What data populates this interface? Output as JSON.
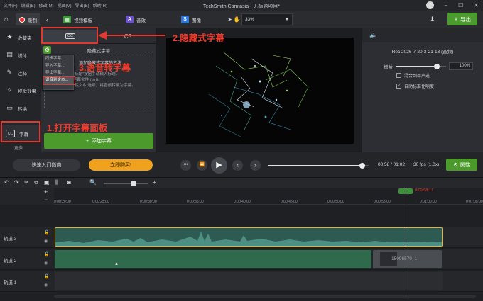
{
  "titlebar": {
    "menus": [
      "文件(F)",
      "编辑(E)",
      "修改(M)",
      "视图(V)",
      "导出(E)",
      "帮助(H)"
    ],
    "app_title": "TechSmith Camtasia - 无标题项目*"
  },
  "toolbar": {
    "record_label": "录制",
    "tabs": [
      {
        "label": "视频模板",
        "color": "#3e9b3a",
        "glyph": "▦"
      },
      {
        "label": "音效",
        "color": "#6c52c7",
        "glyph": "A"
      },
      {
        "label": "图像",
        "color": "#2f76d6",
        "glyph": "S"
      }
    ],
    "zoom": "33%",
    "export_label": "导出"
  },
  "sidebar": {
    "items": [
      {
        "label": "收藏夹",
        "icon": "star-icon",
        "glyph": "★"
      },
      {
        "label": "媒体",
        "icon": "media-icon",
        "glyph": "▤"
      },
      {
        "label": "注释",
        "icon": "annotation-icon",
        "glyph": "✎"
      },
      {
        "label": "视觉效果",
        "icon": "visual-effects-icon",
        "glyph": "✧"
      },
      {
        "label": "转换",
        "icon": "transition-icon",
        "glyph": "▭"
      },
      {
        "label": "字幕",
        "icon": "cc-icon",
        "glyph": "CC"
      }
    ],
    "more_label": "更多"
  },
  "caption_panel": {
    "tab_cc": "CC",
    "tab_c3": "C3",
    "title": "隐藏式字幕",
    "dropdown": [
      "同步字幕...",
      "导入字幕...",
      "导出字幕...",
      "语音到文本..."
    ],
    "guide_title": "添加隐藏式字幕的方法",
    "guide_lines": [
      "- 单击\"添加标题\"按钮手动输入标题。",
      "- 拖拽现有字幕文件 (.srt)。",
      "- 选择\"语音转文本\"选项，将音频转录为字幕。"
    ],
    "add_button": "添加字幕"
  },
  "properties": {
    "clip_name": "Rec 2026-7-20-3-21-13 (音频)",
    "gain_label": "增益",
    "gain_value": "100%",
    "gain_level": 0.82,
    "mix_mono_label": "混合到单声道",
    "mix_mono_checked": false,
    "auto_normalize_label": "自动标准化响度",
    "auto_normalize_checked": true
  },
  "playback": {
    "guide_label": "快速入门指南",
    "buy_label": "立即购买!",
    "time": "00:58 / 01:02",
    "fps": "30 fps (1.0x)",
    "props_label": "属性",
    "progress": 0.93
  },
  "timeline": {
    "playhead_time": "0:00:58;17",
    "ticks": [
      "0:00:20;00",
      "0:00:25;00",
      "0:00:30;00",
      "0:00:35;00",
      "0:00:40;00",
      "0:00:45;00",
      "0:00:50;00",
      "0:00:55;00",
      "0:01:00;00",
      "0:01:05;00"
    ],
    "tracks": [
      {
        "name": "轨道 3"
      },
      {
        "name": "轨道 2",
        "clip_label": "1509657​9_1"
      },
      {
        "name": "轨道 1"
      }
    ]
  },
  "annotations": {
    "step1": "1.打开字幕面板",
    "step2": "2.隐藏式字幕",
    "step3": "3.语音转字幕"
  },
  "colors": {
    "accent_green": "#4c9a2c",
    "annotation_red": "#e0392f",
    "buy_orange": "#f0a21e"
  }
}
